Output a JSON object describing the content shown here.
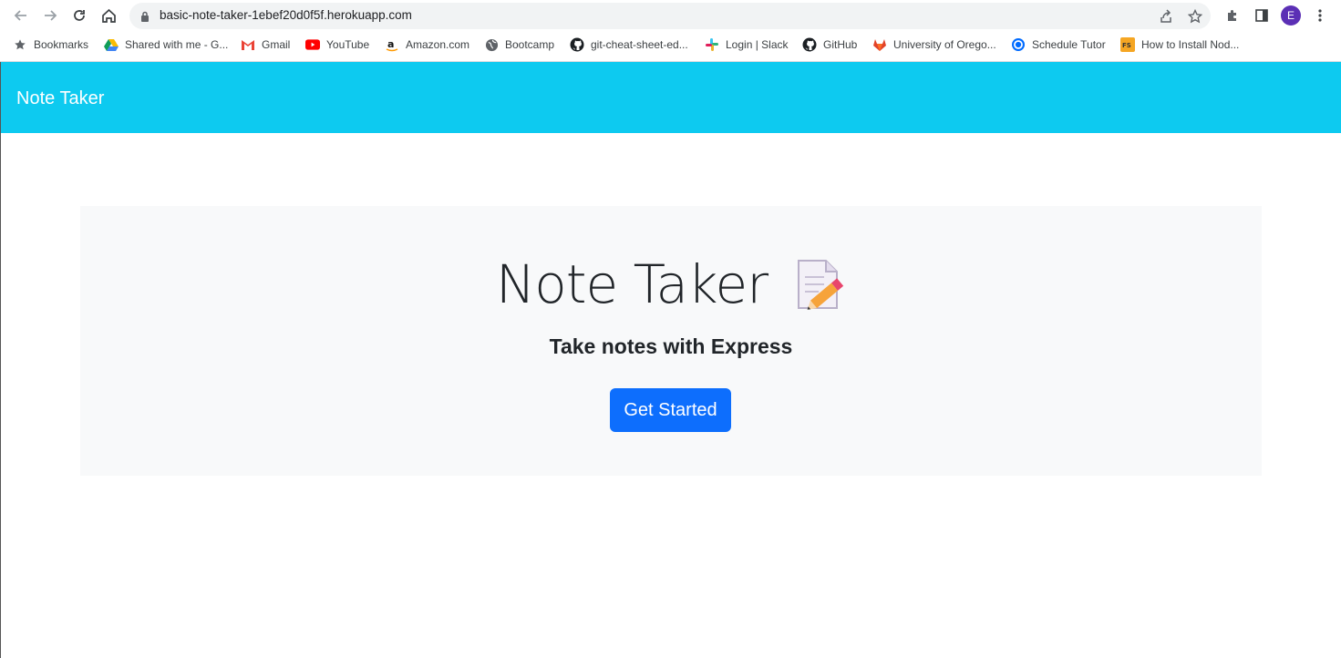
{
  "browser": {
    "url": "basic-note-taker-1ebef20d0f5f.herokuapp.com",
    "avatar_letter": "E",
    "bookmarks": [
      {
        "label": "Bookmarks",
        "icon": "star-icon"
      },
      {
        "label": "Shared with me - G...",
        "icon": "google-drive-icon"
      },
      {
        "label": "Gmail",
        "icon": "gmail-icon"
      },
      {
        "label": "YouTube",
        "icon": "youtube-icon"
      },
      {
        "label": "Amazon.com",
        "icon": "amazon-icon"
      },
      {
        "label": "Bootcamp",
        "icon": "globe-icon"
      },
      {
        "label": "git-cheat-sheet-ed...",
        "icon": "github-icon"
      },
      {
        "label": "Login | Slack",
        "icon": "slack-icon"
      },
      {
        "label": "GitHub",
        "icon": "github-icon"
      },
      {
        "label": "University of Orego...",
        "icon": "gitlab-icon"
      },
      {
        "label": "Schedule Tutor",
        "icon": "calendly-icon"
      },
      {
        "label": "How to Install Nod...",
        "icon": "fs-icon"
      }
    ]
  },
  "navbar": {
    "brand": "Note Taker",
    "color": "#0dcaf0"
  },
  "hero": {
    "title": "Note Taker",
    "icon": "memo-icon",
    "subtitle": "Take notes with Express",
    "button_label": "Get Started",
    "button_color": "#0d6efd"
  }
}
